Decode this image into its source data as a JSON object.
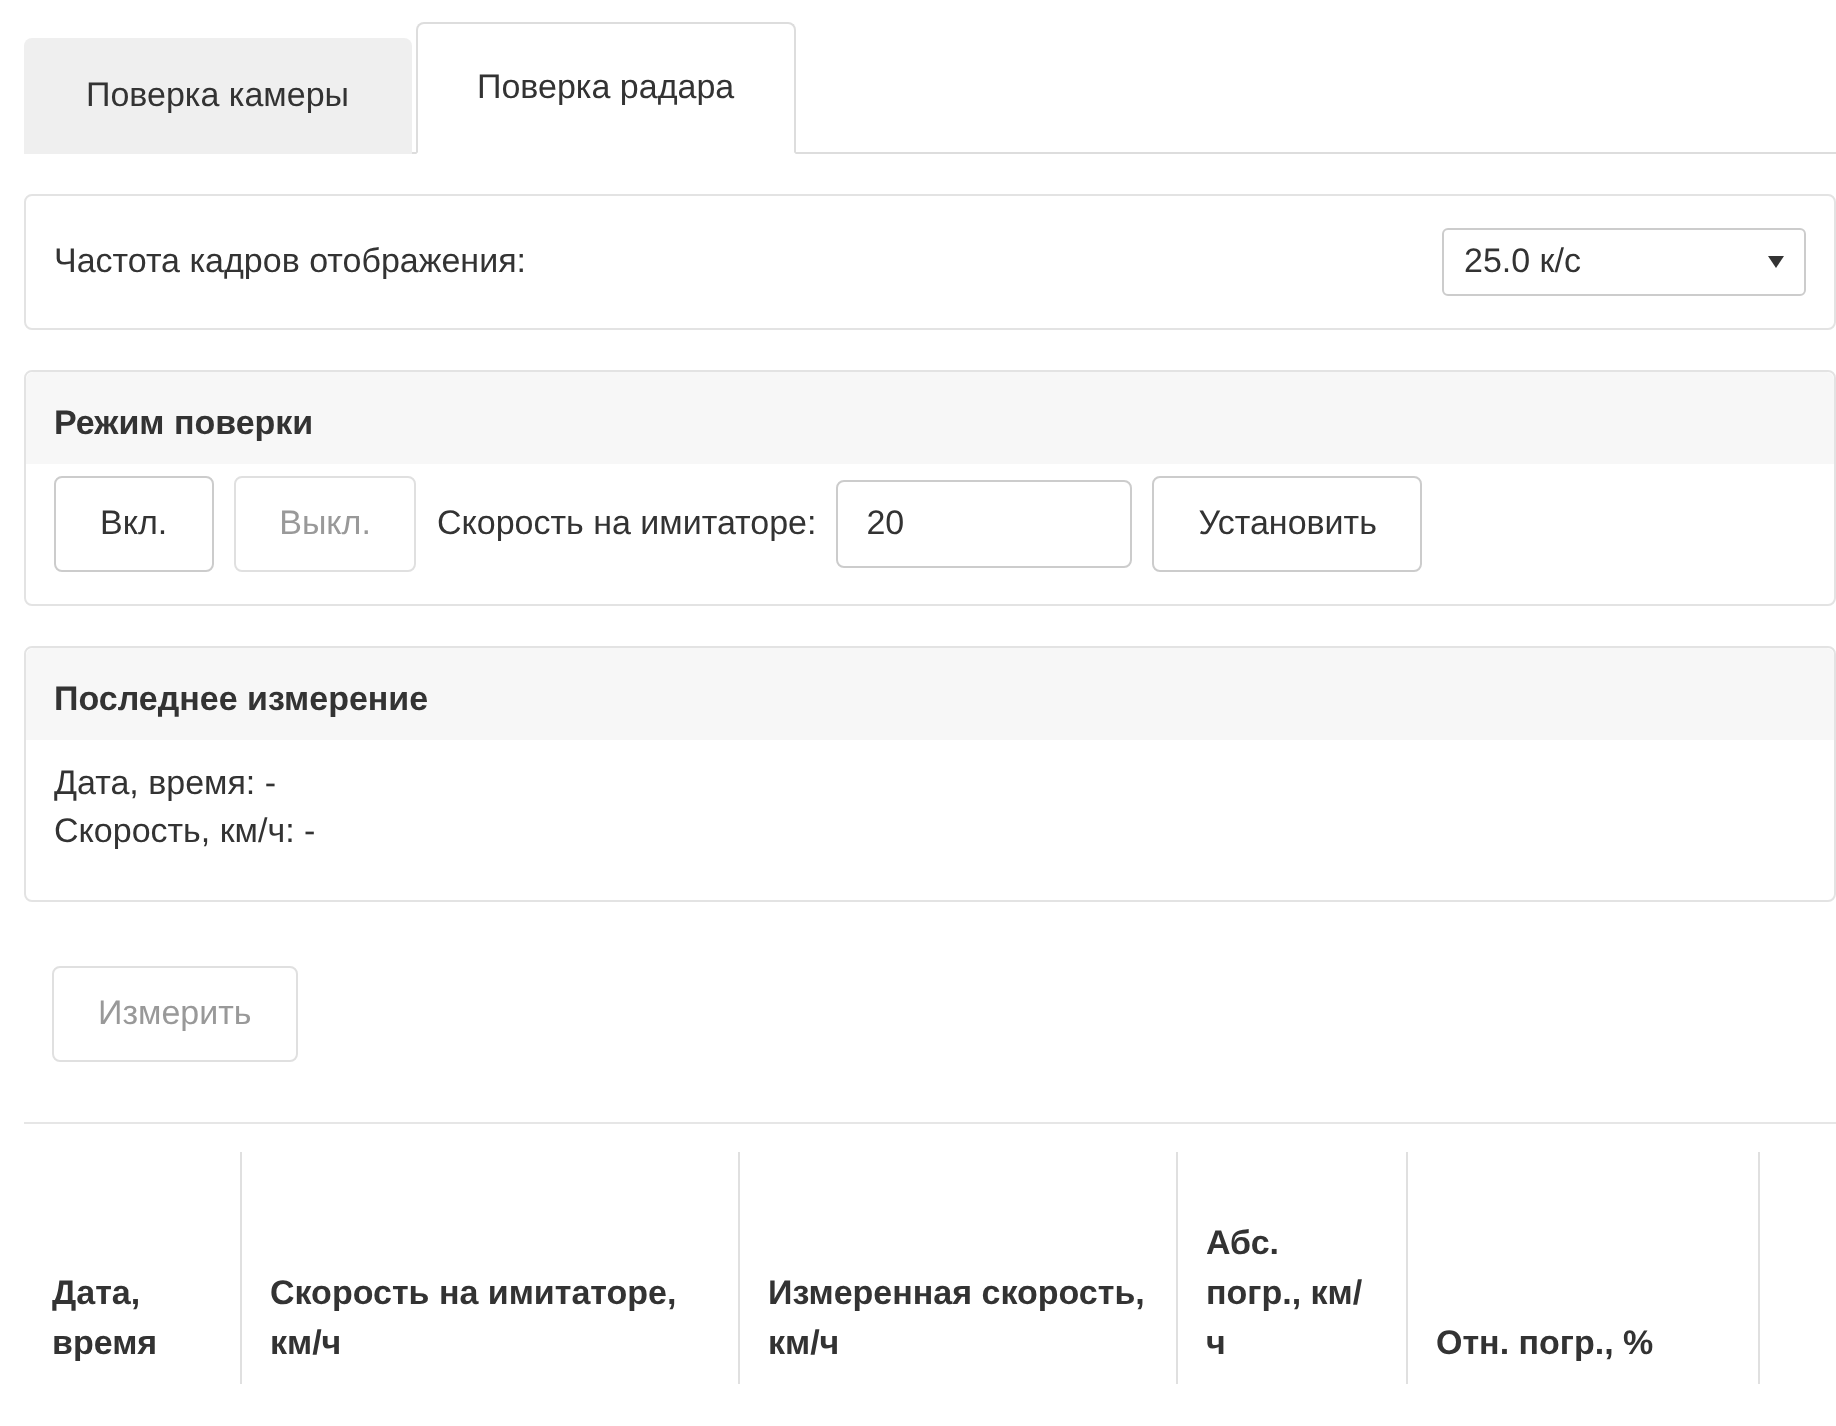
{
  "tabs": [
    {
      "label": "Поверка камеры",
      "selected": false
    },
    {
      "label": "Поверка радара",
      "selected": true
    }
  ],
  "frame_rate": {
    "label": "Частота кадров отображения:",
    "value": "25.0 к/с"
  },
  "mode_panel": {
    "title": "Режим поверки",
    "buttons": [
      {
        "label": "Вкл.",
        "disabled": false
      },
      {
        "label": "Выкл.",
        "disabled": true
      }
    ],
    "speed_label": "Скорость на имитаторе:",
    "speed_value": "20",
    "set_button": {
      "label": "Установить",
      "disabled": false
    }
  },
  "last_panel": {
    "title": "Последнее измерение",
    "lines": [
      "Дата, время: -",
      "Скорость, км/ч: -"
    ]
  },
  "measure_button": {
    "label": "Измерить",
    "disabled": true
  },
  "table": {
    "columns": [
      "Дата, время",
      "Скорость на имитаторе, км/ч",
      "Измеренная скорость, км/ч",
      "Абс. погр., км/ч",
      "Отн. погр., %"
    ]
  }
}
